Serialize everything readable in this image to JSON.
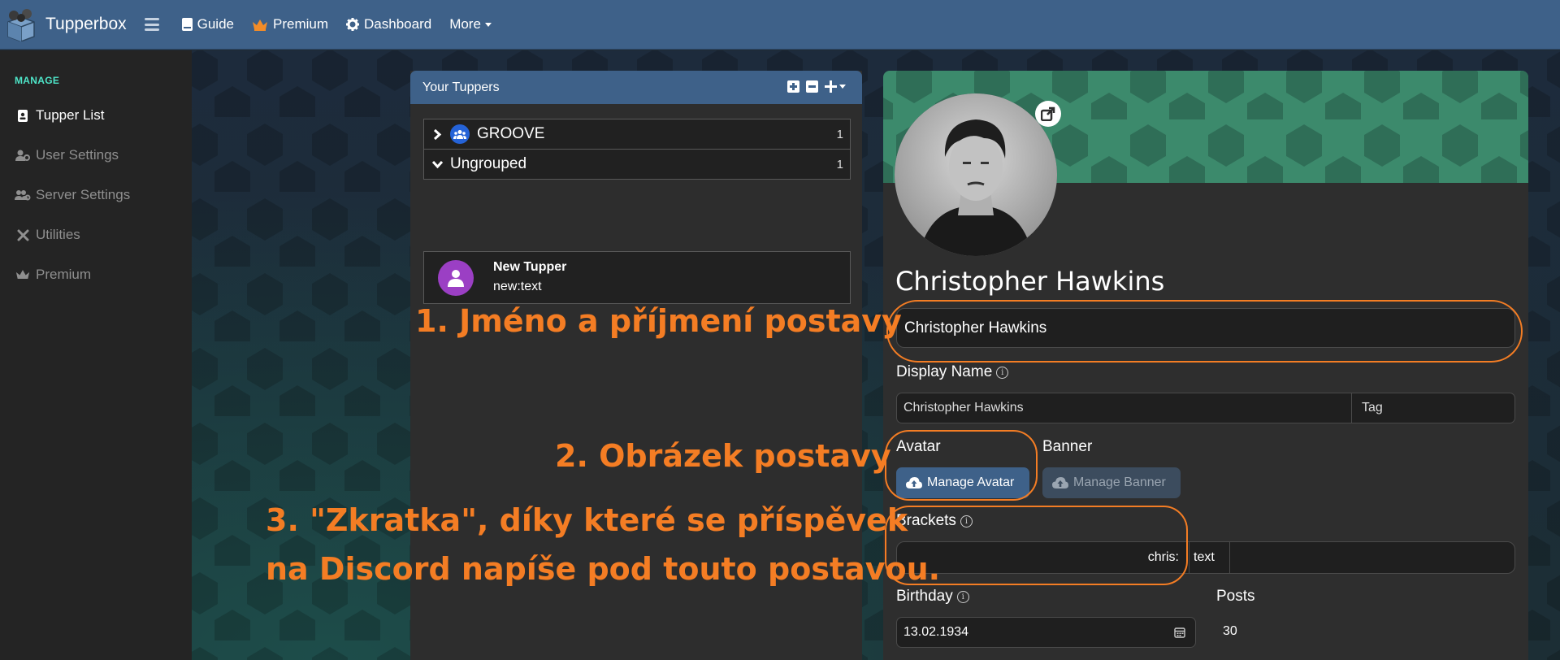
{
  "navbar": {
    "brand": "Tupperbox",
    "links": [
      {
        "label": "Guide",
        "icon": "book-icon"
      },
      {
        "label": "Premium",
        "icon": "crown-icon"
      },
      {
        "label": "Dashboard",
        "icon": "gear-icon"
      },
      {
        "label": "More",
        "icon": "caret-down-icon"
      }
    ],
    "colors": {
      "bar": "#3e6189",
      "crown": "#f28c28"
    }
  },
  "sidebar": {
    "heading": "MANAGE",
    "items": [
      {
        "label": "Tupper List",
        "icon": "contact-card-icon",
        "active": true
      },
      {
        "label": "User Settings",
        "icon": "user-cog-icon",
        "active": false
      },
      {
        "label": "Server Settings",
        "icon": "users-cog-icon",
        "active": false
      },
      {
        "label": "Utilities",
        "icon": "tools-icon",
        "active": false
      },
      {
        "label": "Premium",
        "icon": "crown-icon",
        "active": false
      }
    ]
  },
  "tuppers_panel": {
    "title": "Your Tuppers",
    "groups": [
      {
        "name": "GROOVE",
        "count": "1",
        "expanded": false
      },
      {
        "name": "Ungrouped",
        "count": "1",
        "expanded": true
      }
    ],
    "tupper": {
      "name": "New Tupper",
      "brackets": "new:text"
    }
  },
  "detail": {
    "title": "Christopher Hawkins",
    "name_value": "Christopher Hawkins",
    "display_name_label": "Display Name",
    "display_name_value": "Christopher Hawkins",
    "tag_placeholder": "Tag",
    "avatar_label": "Avatar",
    "banner_label": "Banner",
    "manage_avatar": "Manage Avatar",
    "manage_banner": "Manage Banner",
    "brackets_label": "Brackets",
    "bracket_prefix": "chris:",
    "bracket_text": "text",
    "birthday_label": "Birthday",
    "birthday_value": "13.02.1934",
    "posts_label": "Posts",
    "posts_value": "30"
  },
  "annotations": {
    "a1": "1. Jméno a příjmení postavy",
    "a2": "2. Obrázek postavy",
    "a3_line1": "3. \"Zkratka\", díky které se příspěvek",
    "a3_line2": "na Discord napíše pod touto postavou.",
    "color": "#f47d24"
  }
}
